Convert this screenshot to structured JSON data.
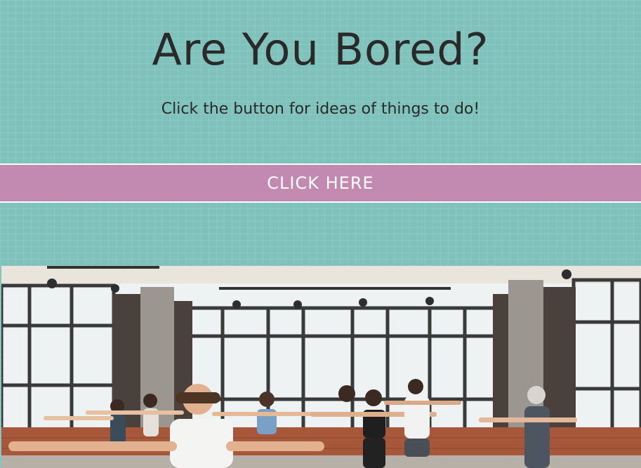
{
  "header": {
    "title": "Are You Bored?",
    "subtitle": "Click the button for ideas of things to do!"
  },
  "cta": {
    "label": "CLICK HERE"
  },
  "photo": {
    "subject": "yoga-class-image"
  },
  "colors": {
    "background": "#7fc2bb",
    "button": "#c289b1",
    "text": "#2a2a2a",
    "button_text": "#ffffff"
  }
}
